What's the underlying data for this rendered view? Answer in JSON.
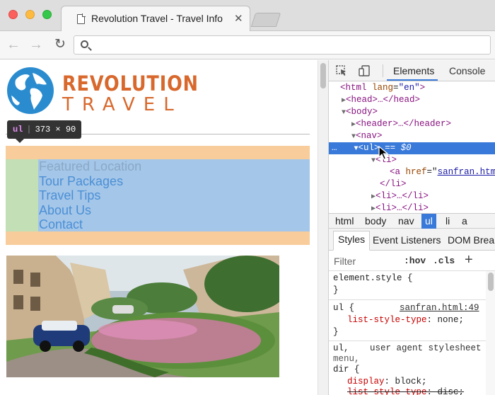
{
  "browser": {
    "tab_title": "Revolution Travel - Travel Info",
    "tab_close": "✕",
    "nav": {
      "back": "←",
      "forward": "→",
      "reload": "↻"
    },
    "address": ""
  },
  "page": {
    "brand_line1": "REVOLUTION",
    "brand_line2": "TRAVEL",
    "inspect_tooltip": {
      "tag": "ul",
      "size": "373 × 90"
    },
    "nav_items": [
      "Featured Location",
      "Tour Packages",
      "Travel Tips",
      "About Us",
      "Contact"
    ]
  },
  "devtools": {
    "tabs": {
      "elements": "Elements",
      "console": "Console"
    },
    "tree": {
      "html_open": "<html",
      "lang_attr": "lang",
      "lang_val": "\"en\"",
      "gt": ">",
      "head": "<head>…</head>",
      "body_open": "<body>",
      "header": "<header>…</header>",
      "nav_open": "<nav>",
      "ul_open": "<ul>",
      "selected_marker": "== $0",
      "ellipsis": "…",
      "li_open": "<li>",
      "a_open": "<a",
      "href_attr": "href",
      "href_val": "sanfran.html",
      "li_close": "</li>",
      "li_collapsed_1": "<li>…</li>",
      "li_collapsed_2": "<li>…</li>"
    },
    "breadcrumbs": [
      "html",
      "body",
      "nav",
      "ul",
      "li",
      "a"
    ],
    "active_breadcrumb": "ul",
    "styles_tabs": {
      "styles": "Styles",
      "listeners": "Event Listeners",
      "dom": "DOM Breakpoints"
    },
    "filter": {
      "placeholder": "Filter",
      "hov": ":hov",
      "cls": ".cls",
      "add": "+"
    },
    "rules": {
      "element_style": "element.style {",
      "close": "}",
      "ul_selector": "ul {",
      "ul_source": "sanfran.html:49",
      "ul_prop": "list-style-type",
      "ul_val": "none;",
      "ua_selector_1": "ul,",
      "ua_label": "user agent stylesheet",
      "ua_selector_2": "menu,",
      "ua_selector_3": "dir {",
      "display_prop": "display",
      "display_val": "block;",
      "lst_prop": "list-style-type",
      "lst_val": "disc;"
    }
  },
  "colors": {
    "brand_orange": "#d8682c",
    "nav_link_blue": "#4b8fd6",
    "margin_overlay": "#f8cc9b",
    "padding_overlay": "#c2dfb5",
    "content_overlay": "#a4c6e8",
    "selection_blue": "#3879d9"
  }
}
